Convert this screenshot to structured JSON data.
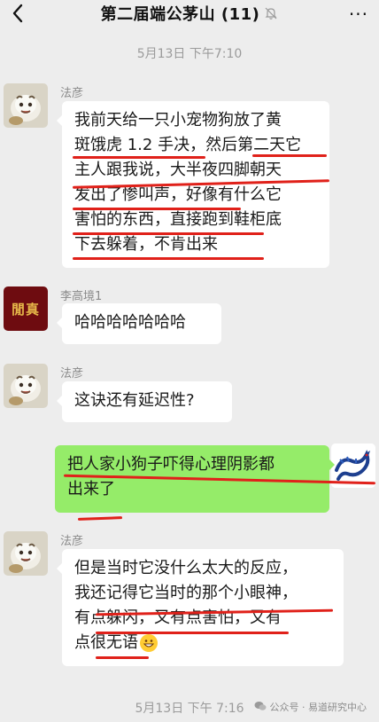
{
  "header": {
    "title": "第二届端公茅山 (11)",
    "more_label": "···"
  },
  "messages": {
    "timestamp_top": "5月13日 下午7:10",
    "m1": {
      "sender": "法彦",
      "lines": [
        "我前天给一只小宠物狗放了黄",
        "斑饿虎 1.2 手决，然后第二天它",
        "主人跟我说，大半夜四脚朝天",
        "发出了惨叫声，好像有什么它",
        "害怕的东西，直接跑到鞋柜底",
        "下去躲着，不肯出来"
      ]
    },
    "m2": {
      "sender": "李高境1",
      "avatar_text": "閒真",
      "text": "哈哈哈哈哈哈哈"
    },
    "m3": {
      "sender": "法彦",
      "text": "这诀还有延迟性?"
    },
    "m4": {
      "lines": [
        "把人家小狗子吓得心理阴影都",
        "出来了"
      ]
    },
    "m5": {
      "sender": "法彦",
      "lines": [
        "但是当时它没什么太大的反应，",
        "我还记得它当时的那个小眼神，",
        "有点躲闪，又有点害怕，又有",
        "点很无语"
      ]
    },
    "timestamp_bottom": "5月13日 下午 7:16",
    "watermark": "公众号 · 易道研究中心"
  },
  "colors": {
    "background": "#ededed",
    "bubble_white": "#ffffff",
    "bubble_green": "#95ec69",
    "annotation_red": "#e0211a"
  }
}
